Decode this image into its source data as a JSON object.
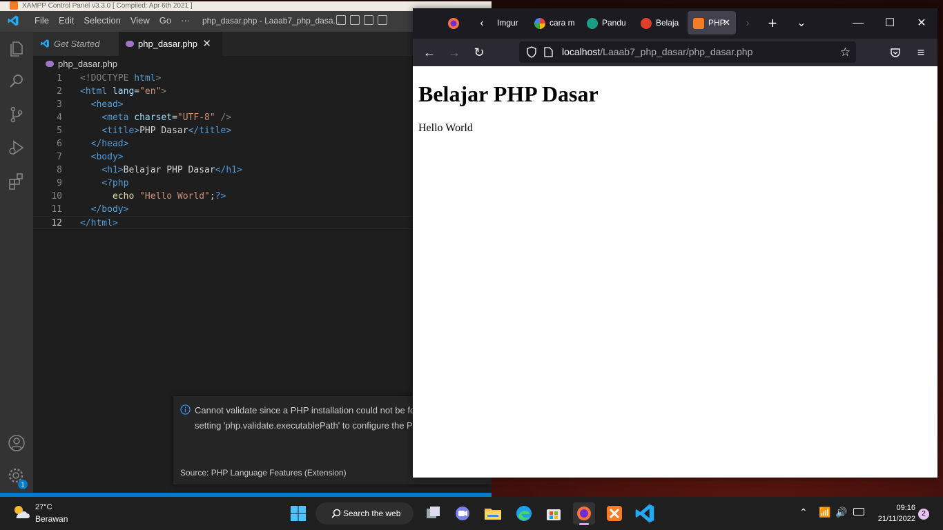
{
  "xampp": {
    "title": "XAMPP Control Panel v3.3.0   [ Compiled: Apr 6th 2021 ]"
  },
  "vscode": {
    "menu": [
      "File",
      "Edit",
      "Selection",
      "View",
      "Go",
      "···"
    ],
    "window_title": "php_dasar.php - Laaab7_php_dasa...",
    "tabs": [
      {
        "label": "Get Started"
      },
      {
        "label": "php_dasar.php"
      }
    ],
    "breadcrumb": "php_dasar.php",
    "lines": [
      {
        "n": "1"
      },
      {
        "n": "2"
      },
      {
        "n": "3"
      },
      {
        "n": "4"
      },
      {
        "n": "5"
      },
      {
        "n": "6"
      },
      {
        "n": "7"
      },
      {
        "n": "8"
      },
      {
        "n": "9"
      },
      {
        "n": "10"
      },
      {
        "n": "11"
      },
      {
        "n": "12"
      }
    ],
    "code": {
      "doctype": "<!DOCTYPE",
      "html_kw": "html",
      "html_open": "<html",
      "lang_attr": "lang",
      "lang_val": "\"en\"",
      "head_open": "<head>",
      "meta_open": "<meta",
      "charset_attr": "charset",
      "charset_val": "\"UTF-8\"",
      "self_close": "/>",
      "title_open": "<title>",
      "title_text": "PHP Dasar",
      "title_close": "</title>",
      "head_close": "</head>",
      "body_open": "<body>",
      "h1_open": "<h1>",
      "h1_text": "Belajar PHP Dasar",
      "h1_close": "</h1>",
      "php_open": "<?php",
      "echo": "echo",
      "echo_str": "\"Hello World\"",
      "php_close": "?>",
      "body_close": "</body>",
      "html_close": "</html>"
    },
    "notification": {
      "message": "Cannot validate since a PHP installation could not be found. Use the setting 'php.validate.executablePath' to configure the PHP executable.",
      "source": "Source: PHP Language Features (Extension)"
    },
    "settings_badge": "1"
  },
  "firefox": {
    "tabs": [
      {
        "label": "Imgur"
      },
      {
        "label": "cara m"
      },
      {
        "label": "Pandu"
      },
      {
        "label": "Belaja"
      },
      {
        "label": "PHP"
      }
    ],
    "url_host": "localhost",
    "url_path": "/Laaab7_php_dasar/php_dasar.php",
    "page": {
      "heading": "Belajar PHP Dasar",
      "text": "Hello World"
    }
  },
  "taskbar": {
    "weather_temp": "27°C",
    "weather_cond": "Berawan",
    "search_label": "Search the web",
    "time": "09:16",
    "date": "21/11/2022",
    "notification_count": "2"
  },
  "colors": {
    "vscode_bg": "#1e1e1e",
    "vscode_accent": "#007acc",
    "firefox_toolbar": "#2b2a33",
    "taskbar": "#1f1f1f"
  }
}
